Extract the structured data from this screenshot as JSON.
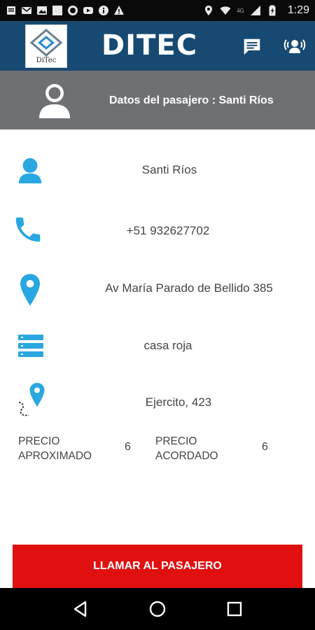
{
  "status_bar": {
    "time": "1:29",
    "network": "4G",
    "icons": [
      "notification-icon",
      "mail-icon",
      "image-icon",
      "square-icon",
      "circle-icon",
      "youtube-icon",
      "info-icon",
      "warning-icon",
      "location-icon",
      "wifi-icon",
      "signal-icon",
      "battery-icon"
    ]
  },
  "app_bar": {
    "logo_text": "DiTec",
    "title": "DITEC",
    "icons": [
      "chat-icon",
      "alarm-user-icon"
    ]
  },
  "header": {
    "label": "Datos del pasajero : Santi Ríos",
    "icon": "user-avatar-icon"
  },
  "details": {
    "name": "Santi Ríos",
    "phone": "+51 932627702",
    "origin": "Av María Parado de Bellido 385",
    "reference": "casa roja",
    "destination": "Ejercito, 423"
  },
  "prices": {
    "approx_label_line1": "PRECIO",
    "approx_label_line2": "APROXIMADO",
    "approx_value": "6",
    "agreed_label_line1": "PRECIO",
    "agreed_label_line2": "ACORDADO",
    "agreed_value": "6"
  },
  "actions": {
    "call_label": "LLAMAR AL PASAJERO"
  },
  "colors": {
    "app_bar": "#174a72",
    "header": "#6e7074",
    "accent": "#29a7e1",
    "call_button": "#e01010"
  }
}
